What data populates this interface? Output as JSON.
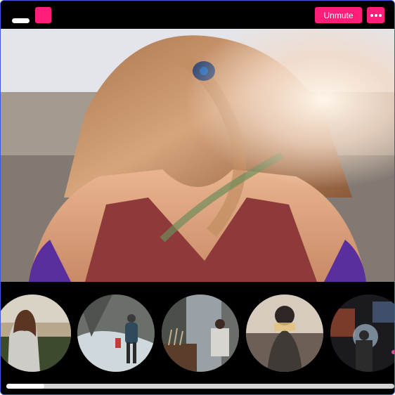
{
  "toolbar": {
    "unmute_label": "Unmute",
    "more_icon": "more-horizontal-icon",
    "accent": "#ff1f7a"
  },
  "hero": {
    "image": "woman-with-blowing-hair-photo"
  },
  "thumbnails": [
    {
      "image": "woman-looking-at-hills-photo"
    },
    {
      "image": "hikers-in-snow-photo"
    },
    {
      "image": "man-with-incense-photo"
    },
    {
      "image": "woman-double-exposure-photo"
    },
    {
      "image": "person-with-umbrella-night-photo"
    }
  ]
}
